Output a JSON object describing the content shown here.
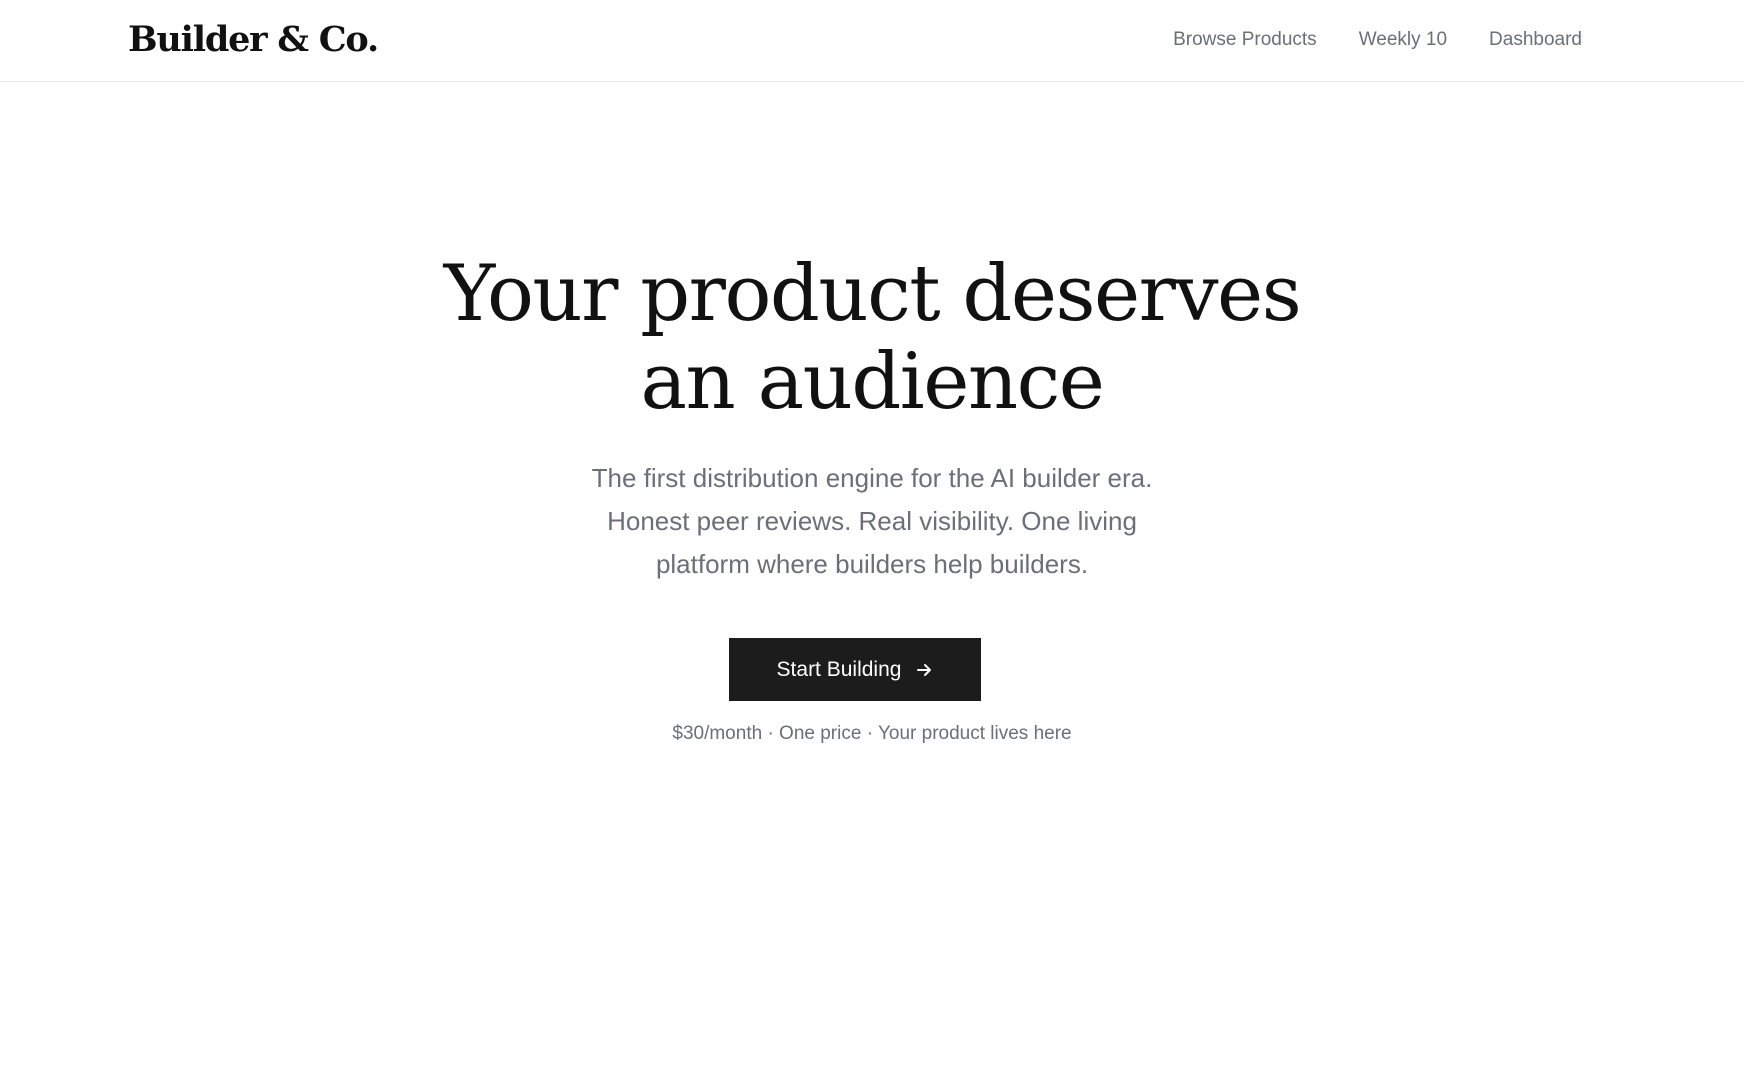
{
  "header": {
    "logo_text": "Builder & Co.",
    "nav": [
      {
        "label": "Browse Products"
      },
      {
        "label": "Weekly 10"
      },
      {
        "label": "Dashboard"
      }
    ]
  },
  "hero": {
    "headline_lines": [
      "Your product deserves",
      "an audience"
    ],
    "subtitle_lines": [
      "The first distribution engine for the AI builder era.",
      "Honest peer reviews. Real visibility. One living",
      "platform where builders help builders."
    ],
    "cta_label": "Start Building",
    "cta_icon": "arrow-right-icon",
    "pricing_note": "$30/month · One price · Your product lives here"
  },
  "colors": {
    "text_primary": "#111111",
    "text_muted": "#6b6f76",
    "button_bg": "#1c1c1c",
    "button_text": "#ffffff",
    "divider": "#e6e6e6"
  }
}
